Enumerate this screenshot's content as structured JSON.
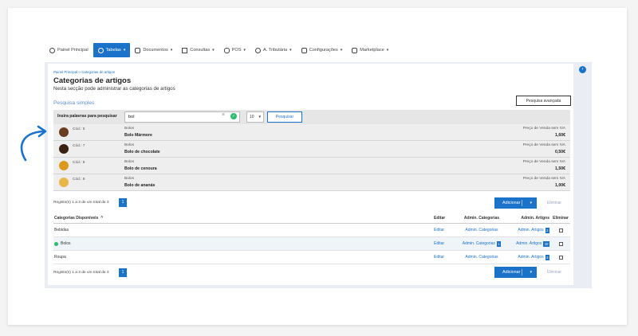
{
  "nav": [
    {
      "label": "Painel Principal",
      "icon": "clock-icon",
      "active": false,
      "caret": false
    },
    {
      "label": "Tabelas",
      "icon": "users-icon",
      "active": true,
      "caret": true
    },
    {
      "label": "Documentos",
      "icon": "document-icon",
      "active": false,
      "caret": true
    },
    {
      "label": "Consultas",
      "icon": "chart-icon",
      "active": false,
      "caret": true
    },
    {
      "label": "POS",
      "icon": "hand-icon",
      "active": false,
      "caret": true
    },
    {
      "label": "A. Tributária",
      "icon": "tax-icon",
      "active": false,
      "caret": true
    },
    {
      "label": "Configurações",
      "icon": "settings-icon",
      "active": false,
      "caret": true
    },
    {
      "label": "Marketplace",
      "icon": "grid-icon",
      "active": false,
      "caret": true
    }
  ],
  "breadcrumb": "Painel Principal > Categorias de artigos",
  "page": {
    "title": "Categorias de artigos",
    "subtitle": "Nesta secção pode administrar as categorias de artigos",
    "simple_search_label": "Pesquisa simples",
    "advanced_search_button": "Pesquisa avançada"
  },
  "search": {
    "label": "Insira palavras para pesquisar",
    "value": "bol",
    "clear": "×",
    "ok_icon": "✓",
    "page_size": "10",
    "button": "Pesquisar"
  },
  "results": [
    {
      "code": "Cód.: 5",
      "category": "Bolos",
      "name": "Bolo Mármore",
      "price_label": "Preço de Venda sem IVA",
      "price": "1,60€",
      "thumb_color": "#6b3d1f"
    },
    {
      "code": "Cód.: 7",
      "category": "Bolos",
      "name": "Bolo de chocolate",
      "price_label": "Preço de Venda sem IVA",
      "price": "0,50€",
      "thumb_color": "#3a2212"
    },
    {
      "code": "Cód.: 8",
      "category": "Bolos",
      "name": "Bolo de cenoura",
      "price_label": "Preço de Venda sem IVA",
      "price": "1,50€",
      "thumb_color": "#d99a1e"
    },
    {
      "code": "Cód.: 9",
      "category": "Bolos",
      "name": "Bolo de ananás",
      "price_label": "Preço de Venda sem IVA",
      "price": "1,00€",
      "thumb_color": "#e6b84a"
    }
  ],
  "pagination_top": {
    "text": "Registo(s) 1 a 3 de um total de 3",
    "page": "1"
  },
  "pagination_bottom": {
    "text": "Registo(s) 1 a 3 de um total de 3",
    "page": "1"
  },
  "actions": {
    "add": "Adicionar",
    "delete": "Eliminar"
  },
  "table": {
    "headers": {
      "name": "Categorias Disponíveis",
      "edit": "Editar",
      "admin_categories": "Admin. Categorias",
      "admin_articles": "Admin. Artigos",
      "delete": "Eliminar"
    },
    "rows": [
      {
        "name": "Bebidas",
        "edit": "Editar",
        "admin_categories": "Admin. Categorias",
        "cat_count": "",
        "admin_articles": "Admin. Artigos",
        "art_count": "2",
        "highlight": false
      },
      {
        "name": "Bolos",
        "edit": "Editar",
        "admin_categories": "Admin. Categorias",
        "cat_count": "1",
        "admin_articles": "Admin. Artigos",
        "art_count": "10",
        "highlight": true
      },
      {
        "name": "Roupa",
        "edit": "Editar",
        "admin_categories": "Admin. Categorias",
        "cat_count": "",
        "admin_articles": "Admin. Artigos",
        "art_count": "3",
        "highlight": false
      }
    ]
  },
  "colors": {
    "accent": "#1a73c8",
    "success": "#2dbd6e"
  }
}
